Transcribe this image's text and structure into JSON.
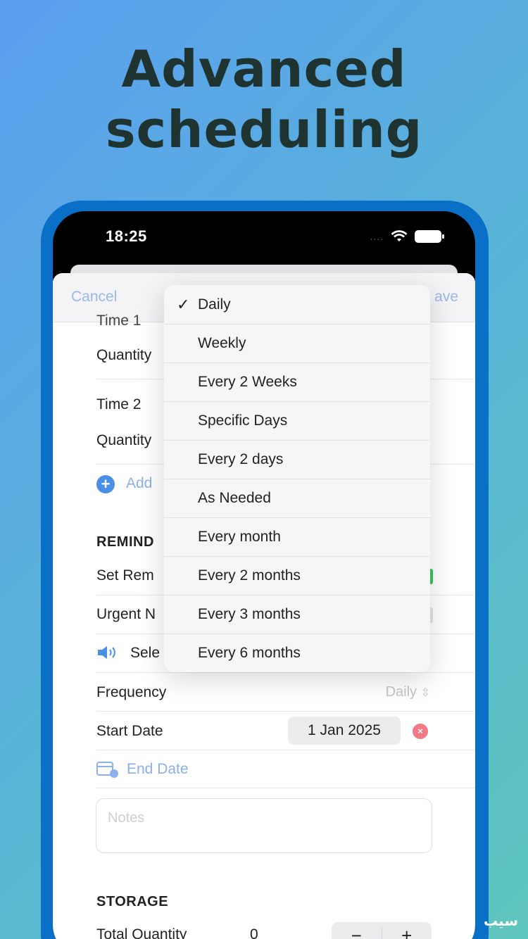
{
  "headline": {
    "line1": "Advanced",
    "line2": "scheduling"
  },
  "status_bar": {
    "time": "18:25",
    "dots": "....",
    "wifi_icon": "wifi-icon",
    "battery_icon": "battery-icon"
  },
  "nav": {
    "cancel": "Cancel",
    "save": "ave"
  },
  "form": {
    "time1_label": "Time 1",
    "quantity1_label": "Quantity",
    "time2_label": "Time 2",
    "quantity2_label": "Quantity",
    "add_label": "Add",
    "reminders_header": "REMIND",
    "set_reminder_label": "Set Rem",
    "urgent_label": "Urgent N",
    "select_label": "Sele",
    "frequency_label": "Frequency",
    "frequency_value": "Daily",
    "start_date_label": "Start Date",
    "start_date_value": "1 Jan 2025",
    "end_date_label": "End Date",
    "notes_placeholder": "Notes",
    "storage_header": "STORAGE",
    "total_quantity_label": "Total Quantity",
    "total_quantity_value": "0",
    "stepper_minus": "−",
    "stepper_plus": "+"
  },
  "frequency_menu": {
    "selected": "Daily",
    "options": [
      "Daily",
      "Weekly",
      "Every 2 Weeks",
      "Specific Days",
      "Every 2 days",
      "As Needed",
      "Every month",
      "Every 2 months",
      "Every 3 months",
      "Every 6 months"
    ]
  },
  "colors": {
    "accent": "#4a8fe6",
    "toggle_on": "#34c759",
    "clear_red": "#f07a86",
    "frame": "#0a6fc6"
  },
  "watermark": "سیب"
}
